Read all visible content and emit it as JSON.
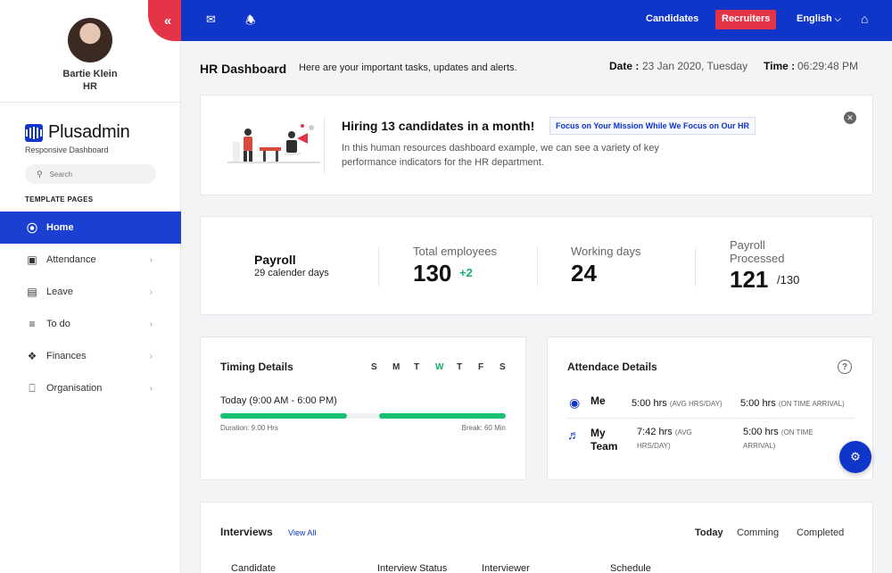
{
  "profile": {
    "name": "Bartie Klein",
    "role": "HR"
  },
  "brand": {
    "name": "Plusadmin",
    "subtitle": "Responsive Dashboard"
  },
  "search": {
    "placeholder": "Search"
  },
  "sidebar": {
    "section_title": "TEMPLATE PAGES",
    "items": [
      {
        "label": "Home",
        "icon": "home-icon",
        "active": true
      },
      {
        "label": "Attendance",
        "icon": "monitor-icon"
      },
      {
        "label": "Leave",
        "icon": "inbox-icon"
      },
      {
        "label": "To do",
        "icon": "list-icon"
      },
      {
        "label": "Finances",
        "icon": "finance-icon"
      },
      {
        "label": "Organisation",
        "icon": "organisation-icon"
      }
    ]
  },
  "topbar": {
    "candidates": "Candidates",
    "recruiters": "Recruiters",
    "language": "English",
    "accent": "#1035c9",
    "alert": "#e53347"
  },
  "header": {
    "title": "HR Dashboard",
    "subtitle": "Here are your important tasks, updates and alerts.",
    "date_label": "Date :",
    "date_value": "23 Jan 2020, Tuesday",
    "time_label": "Time :",
    "time_value": "06:29:48 PM"
  },
  "hiring": {
    "title": "Hiring 13 candidates in a month!",
    "badge": "Focus on Your Mission While We Focus on Our HR",
    "text": "In this human resources dashboard example, we can see a variety of key performance indicators for the HR department."
  },
  "stats": {
    "payroll_title": "Payroll",
    "payroll_sub": "29 calender days",
    "total_label": "Total employees",
    "total_value": "130",
    "total_delta": "+2",
    "working_label": "Working days",
    "working_value": "24",
    "processed_label_1": "Payroll",
    "processed_label_2": "Processed",
    "processed_value": "121",
    "processed_total": "/130"
  },
  "timing": {
    "title": "Timing Details",
    "days": [
      "S",
      "M",
      "T",
      "W",
      "T",
      "F",
      "S"
    ],
    "today_index": 3,
    "today": "Today (9:00 AM - 6:00 PM)",
    "duration": "Duration: 9.00 Hrs",
    "break": "Break: 60 Min"
  },
  "attendance": {
    "title": "Attendace Details",
    "me": {
      "name": "Me",
      "avg": "5:00 hrs",
      "avg_note": "(AVG HRS/DAY)",
      "ontime": "5:00 hrs",
      "ontime_note": "(ON TIME ARRIVAL)"
    },
    "team": {
      "name_1": "My",
      "name_2": "Team",
      "avg": "7:42 hrs",
      "avg_note_1": "(AVG",
      "avg_note_2": "HRS/DAY)",
      "ontime": "5:00 hrs",
      "ontime_note_1": "(ON TIME",
      "ontime_note_2": "ARRIVAL)"
    }
  },
  "interviews": {
    "title": "Interviews",
    "view_all": "View All",
    "tabs": [
      "Today",
      "Comming",
      "Completed"
    ],
    "columns": [
      "Candidate",
      "Interview Status",
      "Interviewer",
      "Schedule"
    ]
  }
}
